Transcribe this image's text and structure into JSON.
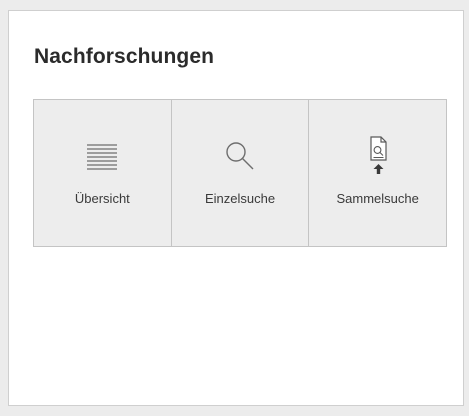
{
  "panel": {
    "title": "Nachforschungen",
    "tiles": [
      {
        "label": "Übersicht",
        "icon": "list-lines-icon"
      },
      {
        "label": "Einzelsuche",
        "icon": "search-icon"
      },
      {
        "label": "Sammelsuche",
        "icon": "document-search-upload-icon"
      }
    ]
  },
  "colors": {
    "background": "#ececec",
    "panel": "#ffffff",
    "tile": "#ededed",
    "border": "#c4c4c4",
    "icon": "#6e6e6e",
    "text": "#3a3a3a"
  }
}
